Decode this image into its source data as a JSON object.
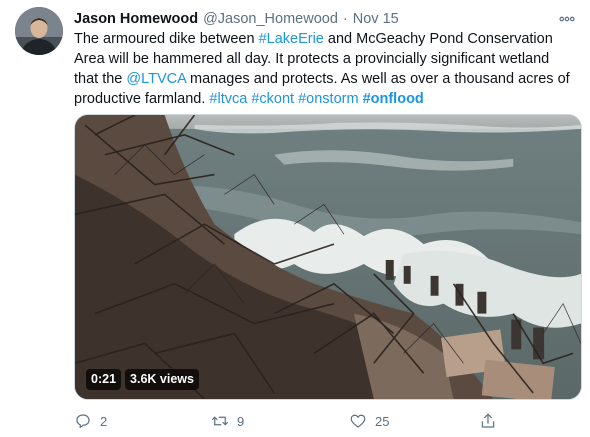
{
  "tweet": {
    "author_name": "Jason Homewood",
    "author_handle": "@Jason_Homewood",
    "separator": "·",
    "date": "Nov 15",
    "lines": [
      [
        {
          "t": "The armoured dike between "
        },
        {
          "t": "#LakeErie",
          "link": true
        },
        {
          "t": " and McGeachy Pond Conservation"
        }
      ],
      [
        {
          "t": "Area will be hammered all day. It protects a provincially significant wetland"
        }
      ],
      [
        {
          "t": "that the "
        },
        {
          "t": "@LTVCA",
          "link": true
        },
        {
          "t": " manages and protects.  As well as over a thousand acres of"
        }
      ],
      [
        {
          "t": "productive farmland. "
        },
        {
          "t": "#ltvca",
          "link": true
        },
        {
          "t": " "
        },
        {
          "t": "#ckont",
          "link": true
        },
        {
          "t": " "
        },
        {
          "t": "#onstorm",
          "link": true
        },
        {
          "t": " "
        },
        {
          "t": "#onflood",
          "link": true,
          "bold": true
        }
      ]
    ]
  },
  "media": {
    "duration": "0:21",
    "views": "3.6K views"
  },
  "actions": {
    "reply_count": "2",
    "retweet_count": "9",
    "like_count": "25"
  },
  "colors": {
    "link": "#1b95e0",
    "secondary_text": "#5b7083",
    "primary_text": "#0f1419"
  },
  "icons": [
    "more-icon",
    "reply-icon",
    "retweet-icon",
    "like-icon",
    "share-icon"
  ]
}
